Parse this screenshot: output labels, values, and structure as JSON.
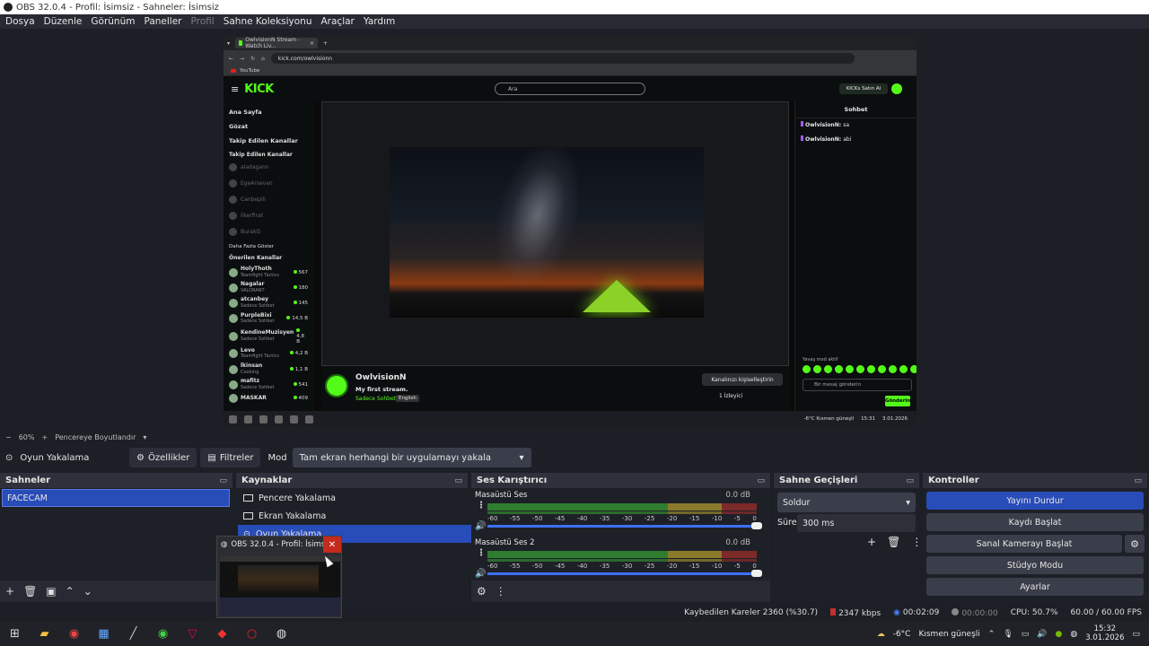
{
  "window": {
    "title": "OBS 32.0.4 - Profil: İsimsiz - Sahneler: İsimsiz"
  },
  "menu": [
    "Dosya",
    "Düzenle",
    "Görünüm",
    "Paneller",
    "Profil",
    "Sahne Koleksiyonu",
    "Araçlar",
    "Yardım"
  ],
  "preview": {
    "browser": {
      "tab_title": "OwlvisionN Stream - Watch Liv...",
      "url": "kick.com/owlvisionn",
      "bookmark": "YouTube"
    },
    "kick": {
      "logo": "KICK",
      "search_placeholder": "Ara",
      "buy_kicks": "KICKs Satın Al",
      "nav": [
        "Ana Sayfa",
        "Gözat",
        "Takip Edilen Kanallar"
      ],
      "followed_title": "Takip Edilen Kanallar",
      "followed": [
        "aladagann",
        "EgeArsevan",
        "Canbepili",
        "ilkerfirat",
        "BurakG"
      ],
      "show_more": "Daha Fazla Göster",
      "recommended_title": "Önerilen Kanallar",
      "recommended": [
        {
          "name": "HolyThoth",
          "cat": "Teamfight Tactics",
          "viewers": "567"
        },
        {
          "name": "Nagalar",
          "cat": "VALORANT",
          "viewers": "180"
        },
        {
          "name": "atcanbey",
          "cat": "Sadece Sohbet",
          "viewers": "145"
        },
        {
          "name": "PurpleBixi",
          "cat": "Sadece Sohbet",
          "viewers": "14,5 B"
        },
        {
          "name": "KendineMuzisyen",
          "cat": "Sadece Sohbet",
          "viewers": "4,8 B"
        },
        {
          "name": "Levo",
          "cat": "Teamfight Tactics",
          "viewers": "4,2 B"
        },
        {
          "name": "lkinsan",
          "cat": "Cooking",
          "viewers": "1,1 B"
        },
        {
          "name": "mafitz",
          "cat": "Sadece Sohbet",
          "viewers": "541"
        },
        {
          "name": "MASKAR",
          "cat": "",
          "viewers": "409"
        }
      ],
      "streamer": "OwlvisionN",
      "stream_title": "My first stream.",
      "category": "Sadece Sohbet",
      "language": "English",
      "customize": "Kanalınızı kişiselleştirin",
      "viewers": "1 İzleyici",
      "chat_title": "Sohbet",
      "chat_messages": [
        {
          "user": "OwlvisionN:",
          "text": "sa"
        },
        {
          "user": "OwlvisionN:",
          "text": "abi"
        }
      ],
      "slow_mode": "Yavaş mod aktif",
      "chat_placeholder": "Bir mesaj gönderin",
      "send": "Gönderin"
    },
    "inner_taskbar": {
      "weather": "-6°C Kısmen güneşli",
      "time": "15:31",
      "date": "3.01.2026"
    }
  },
  "zoom": {
    "minus": "−",
    "value": "60%",
    "plus": "+",
    "fit": "Pencereye Boyutlandır"
  },
  "source_bar": {
    "name": "Oyun Yakalama",
    "properties": "Özellikler",
    "filters": "Filtreler",
    "mode_label": "Mod",
    "mode_value": "Tam ekran herhangi bir uygulamayı yakala"
  },
  "scenes": {
    "title": "Sahneler",
    "items": [
      "FACECAM"
    ]
  },
  "sources": {
    "title": "Kaynaklar",
    "items": [
      "Pencere Yakalama",
      "Ekran Yakalama",
      "Oyun Yakalama"
    ]
  },
  "mixer": {
    "title": "Ses Karıştırıcı",
    "channels": [
      {
        "name": "Masaüstü Ses",
        "db": "0.0 dB"
      },
      {
        "name": "Masaüstü Ses 2",
        "db": "0.0 dB"
      }
    ],
    "ticks": [
      "-60",
      "-55",
      "-50",
      "-45",
      "-40",
      "-35",
      "-30",
      "-25",
      "-20",
      "-15",
      "-10",
      "-5",
      "0"
    ]
  },
  "transitions": {
    "title": "Sahne Geçişleri",
    "type": "Soldur",
    "duration_label": "Süre",
    "duration": "300 ms"
  },
  "controls": {
    "title": "Kontroller",
    "stop_stream": "Yayını Durdur",
    "start_record": "Kaydı Başlat",
    "virtual_cam": "Sanal Kamerayı Başlat",
    "studio": "Stüdyo Modu",
    "settings": "Ayarlar"
  },
  "status": {
    "dropped": "Kaybedilen Kareler 2360 (%30.7)",
    "bitrate": "2347 kbps",
    "stream_time": "00:02:09",
    "rec_time": "00:00:00",
    "cpu": "CPU: 50.7%",
    "fps": "60.00 / 60.00 FPS"
  },
  "thumbnail": {
    "title": "OBS 32.0.4 - Profil: İsimsiz..."
  },
  "taskbar": {
    "weather": "-6°C",
    "weather_desc": "Kısmen güneşli",
    "time": "15:32",
    "date": "3.01.2026"
  },
  "colors": {
    "accent": "#284cb8",
    "kick_green": "#53fc18"
  }
}
